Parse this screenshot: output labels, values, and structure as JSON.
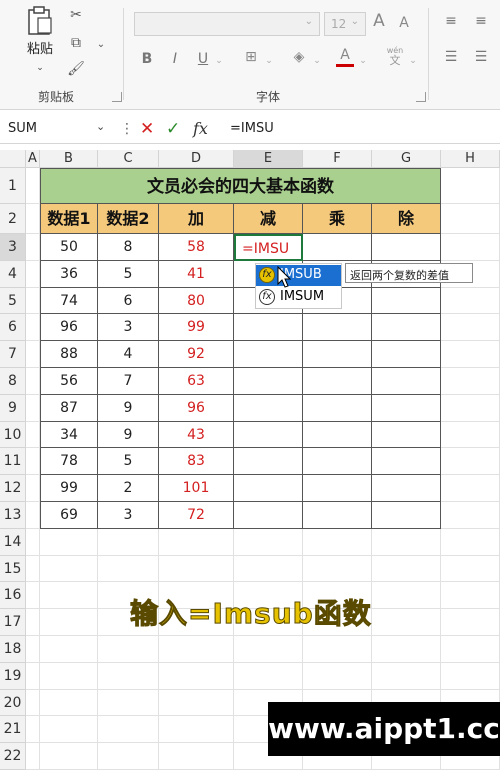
{
  "ribbon": {
    "clipboard": {
      "paste_label": "粘贴",
      "group_label": "剪贴板"
    },
    "font": {
      "size_value": "12",
      "group_label": "字体",
      "bold": "B",
      "italic": "I",
      "underline": "U",
      "grow": "A",
      "shrink": "A",
      "font_color": "A",
      "wen": "wén",
      "wen_sub": "文"
    }
  },
  "formula_bar": {
    "name_box": "SUM",
    "cancel": "✕",
    "enter": "✓",
    "fx": "fx",
    "formula": "=IMSU"
  },
  "grid": {
    "columns": [
      "A",
      "B",
      "C",
      "D",
      "E",
      "F",
      "G",
      "H"
    ],
    "rows": [
      "1",
      "2",
      "3",
      "4",
      "5",
      "6",
      "7",
      "8",
      "9",
      "10",
      "11",
      "12",
      "13",
      "14",
      "15",
      "16",
      "17",
      "18",
      "19",
      "20",
      "21",
      "22"
    ],
    "title": "文员必会的四大基本函数",
    "headers": [
      "数据1",
      "数据2",
      "加",
      "减",
      "乘",
      "除"
    ],
    "data": [
      [
        "50",
        "8",
        "58"
      ],
      [
        "36",
        "5",
        "41"
      ],
      [
        "74",
        "6",
        "80"
      ],
      [
        "96",
        "3",
        "99"
      ],
      [
        "88",
        "4",
        "92"
      ],
      [
        "56",
        "7",
        "63"
      ],
      [
        "87",
        "9",
        "96"
      ],
      [
        "34",
        "9",
        "43"
      ],
      [
        "78",
        "5",
        "83"
      ],
      [
        "99",
        "2",
        "101"
      ],
      [
        "69",
        "3",
        "72"
      ]
    ],
    "editing_cell_value": "=IMSU"
  },
  "autocomplete": {
    "items": [
      "IMSUB",
      "IMSUM"
    ],
    "badge": "fx",
    "tooltip": "返回两个复数的差值"
  },
  "overlay": {
    "caption": "输入=Imsub函数",
    "watermark": "www.aippt1.cc"
  },
  "colors": {
    "title_fill": "#a9d08e",
    "header_fill": "#f4c97c",
    "sum_text": "#d42020",
    "selection": "#1b6fd1",
    "caption": "#e6c200"
  }
}
